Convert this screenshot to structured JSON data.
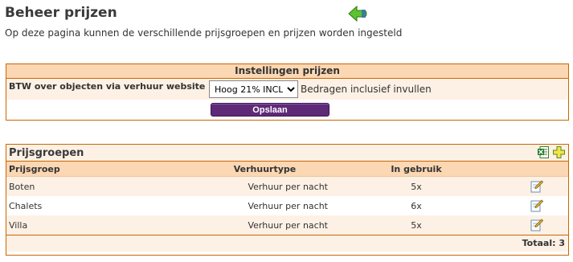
{
  "page": {
    "title": "Beheer prijzen",
    "description": "Op deze pagina kunnen de verschillende prijsgroepen en prijzen worden ingesteld"
  },
  "settings": {
    "header": "Instellingen prijzen",
    "vat_label": "BTW over objecten via verhuur website",
    "vat_selected": "Hoog 21% INCL",
    "vat_hint": "Bedragen inclusief invullen",
    "save_label": "Opslaan"
  },
  "groups": {
    "title": "Prijsgroepen",
    "columns": [
      "Prijsgroep",
      "Verhuurtype",
      "In gebruik",
      ""
    ],
    "rows": [
      {
        "name": "Boten",
        "type": "Verhuur per nacht",
        "in_use": "5x"
      },
      {
        "name": "Chalets",
        "type": "Verhuur per nacht",
        "in_use": "6x"
      },
      {
        "name": "Villa",
        "type": "Verhuur per nacht",
        "in_use": "5x"
      }
    ],
    "total": "Totaal: 3"
  },
  "icons": {
    "back": "back-arrow-icon",
    "excel": "excel-export-icon",
    "add": "add-icon",
    "edit": "edit-pencil-icon"
  },
  "colors": {
    "border": "#cc6600",
    "header_bg": "#fbd7b4",
    "row_bg": "#fdf1e5",
    "button_bg": "#5e2a78"
  }
}
